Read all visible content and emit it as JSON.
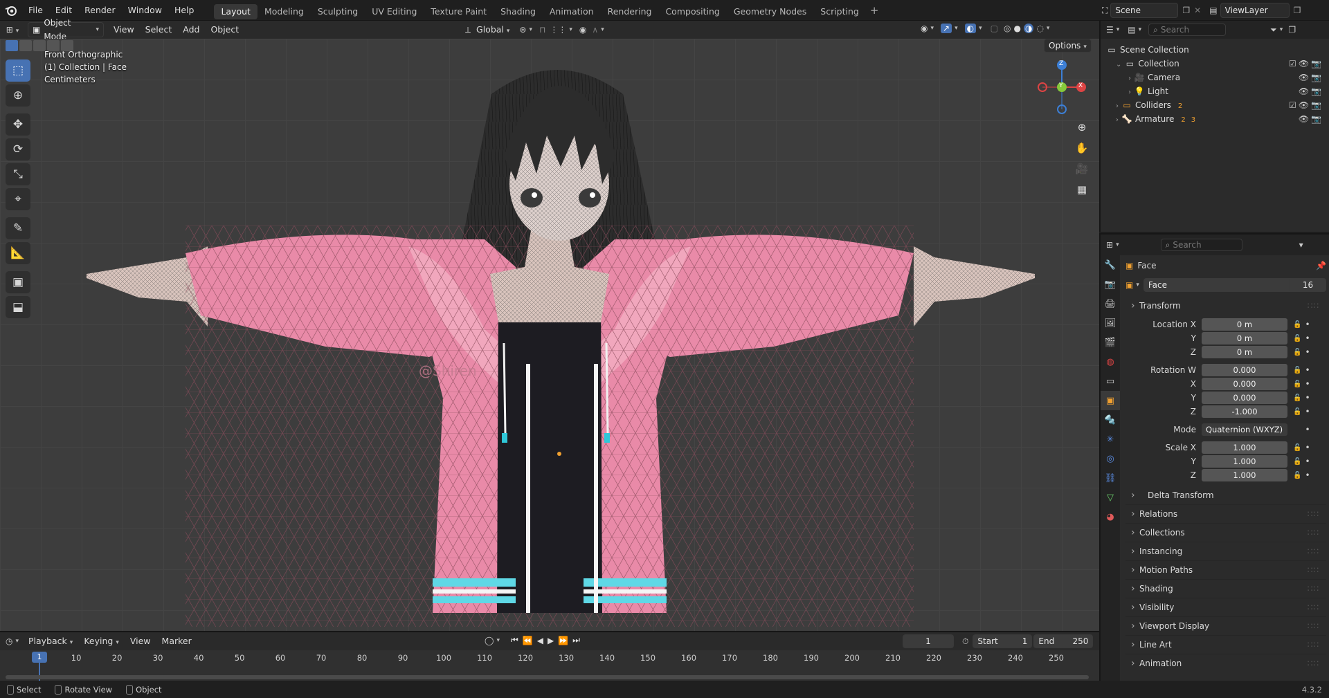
{
  "menus": [
    "File",
    "Edit",
    "Render",
    "Window",
    "Help"
  ],
  "workspaces": [
    "Layout",
    "Modeling",
    "Sculpting",
    "UV Editing",
    "Texture Paint",
    "Shading",
    "Animation",
    "Rendering",
    "Compositing",
    "Geometry Nodes",
    "Scripting"
  ],
  "active_workspace": "Layout",
  "scene": "Scene",
  "view_layer": "ViewLayer",
  "viewport_header": {
    "mode": "Object Mode",
    "menus": [
      "View",
      "Select",
      "Add",
      "Object"
    ],
    "transform_orientation": "Global"
  },
  "viewport": {
    "view_name": "Front Orthographic",
    "context": "(1) Collection | Face",
    "units": "Centimeters",
    "options_label": "Options",
    "gizmo": {
      "z": "Z",
      "y": "Y",
      "x": "X"
    },
    "watermark": "@Shiren"
  },
  "outliner": {
    "search_placeholder": "Search",
    "items": [
      {
        "label": "Scene Collection",
        "icon": "scene-collection-icon"
      },
      {
        "label": "Collection",
        "icon": "collection-icon"
      },
      {
        "label": "Camera",
        "icon": "camera-icon"
      },
      {
        "label": "Light",
        "icon": "light-icon"
      },
      {
        "label": "Colliders",
        "icon": "collection-icon",
        "badge": "2"
      },
      {
        "label": "Armature",
        "icon": "armature-icon",
        "badge": "2",
        "badge2": "3"
      }
    ]
  },
  "properties": {
    "search_placeholder": "Search",
    "object_name": "Face",
    "datablock_name": "Face",
    "users": "16",
    "transform_label": "Transform",
    "location": {
      "label": "Location X",
      "x": "0 m",
      "y": "0 m",
      "z": "0 m"
    },
    "rotation": {
      "label": "Rotation W",
      "w": "0.000",
      "x": "0.000",
      "y": "0.000",
      "z": "-1.000"
    },
    "mode_label": "Mode",
    "mode_value": "Quaternion (WXYZ)",
    "scale": {
      "label": "Scale X",
      "x": "1.000",
      "y": "1.000",
      "z": "1.000"
    },
    "axis_labels": {
      "x": "X",
      "y": "Y",
      "z": "Z"
    },
    "delta_transform": "Delta Transform",
    "panels": [
      "Relations",
      "Collections",
      "Instancing",
      "Motion Paths",
      "Shading",
      "Visibility",
      "Viewport Display",
      "Line Art",
      "Animation"
    ]
  },
  "timeline": {
    "menus": [
      "Playback",
      "Keying",
      "View",
      "Marker"
    ],
    "current_frame": "1",
    "start_label": "Start",
    "start": "1",
    "end_label": "End",
    "end": "250",
    "ticks": [
      "1",
      "10",
      "20",
      "30",
      "40",
      "50",
      "60",
      "70",
      "80",
      "90",
      "100",
      "110",
      "120",
      "130",
      "140",
      "150",
      "160",
      "170",
      "180",
      "190",
      "200",
      "210",
      "220",
      "230",
      "240",
      "250"
    ]
  },
  "statusbar": {
    "items": [
      "Select",
      "Rotate View",
      "Object"
    ],
    "version": "4.3.2"
  },
  "colors": {
    "accent": "#4772b3",
    "jacket": "#e98aa8",
    "hair": "#2c2c2c",
    "cyan_stripe": "#5fd8e6"
  }
}
